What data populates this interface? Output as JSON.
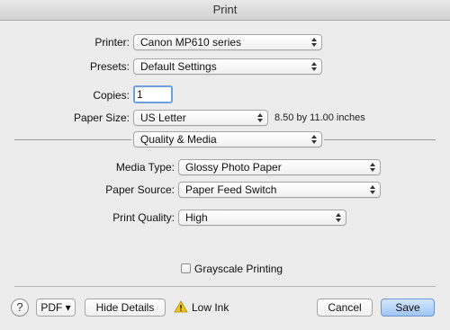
{
  "window": {
    "title": "Print"
  },
  "printer": {
    "label": "Printer:",
    "value": "Canon MP610 series"
  },
  "presets": {
    "label": "Presets:",
    "value": "Default Settings"
  },
  "copies": {
    "label": "Copies:",
    "value": "1"
  },
  "paper_size": {
    "label": "Paper Size:",
    "value": "US Letter",
    "dimensions": "8.50 by 11.00 inches"
  },
  "section": {
    "value": "Quality & Media"
  },
  "media_type": {
    "label": "Media Type:",
    "value": "Glossy Photo Paper"
  },
  "paper_source": {
    "label": "Paper Source:",
    "value": "Paper Feed Switch"
  },
  "print_quality": {
    "label": "Print Quality:",
    "value": "High"
  },
  "grayscale": {
    "label": "Grayscale Printing",
    "checked": false
  },
  "footer": {
    "help_glyph": "?",
    "pdf_label": "PDF ▾",
    "hide_details_label": "Hide Details",
    "low_ink_label": "Low Ink",
    "cancel_label": "Cancel",
    "save_label": "Save"
  },
  "colors": {
    "accent": "#6a9fe0",
    "warning": "#f0c419",
    "default_button": "#9fc5f4"
  },
  "icons": [
    "popup-arrows-icon",
    "help-icon",
    "warning-icon",
    "checkbox-icon"
  ]
}
